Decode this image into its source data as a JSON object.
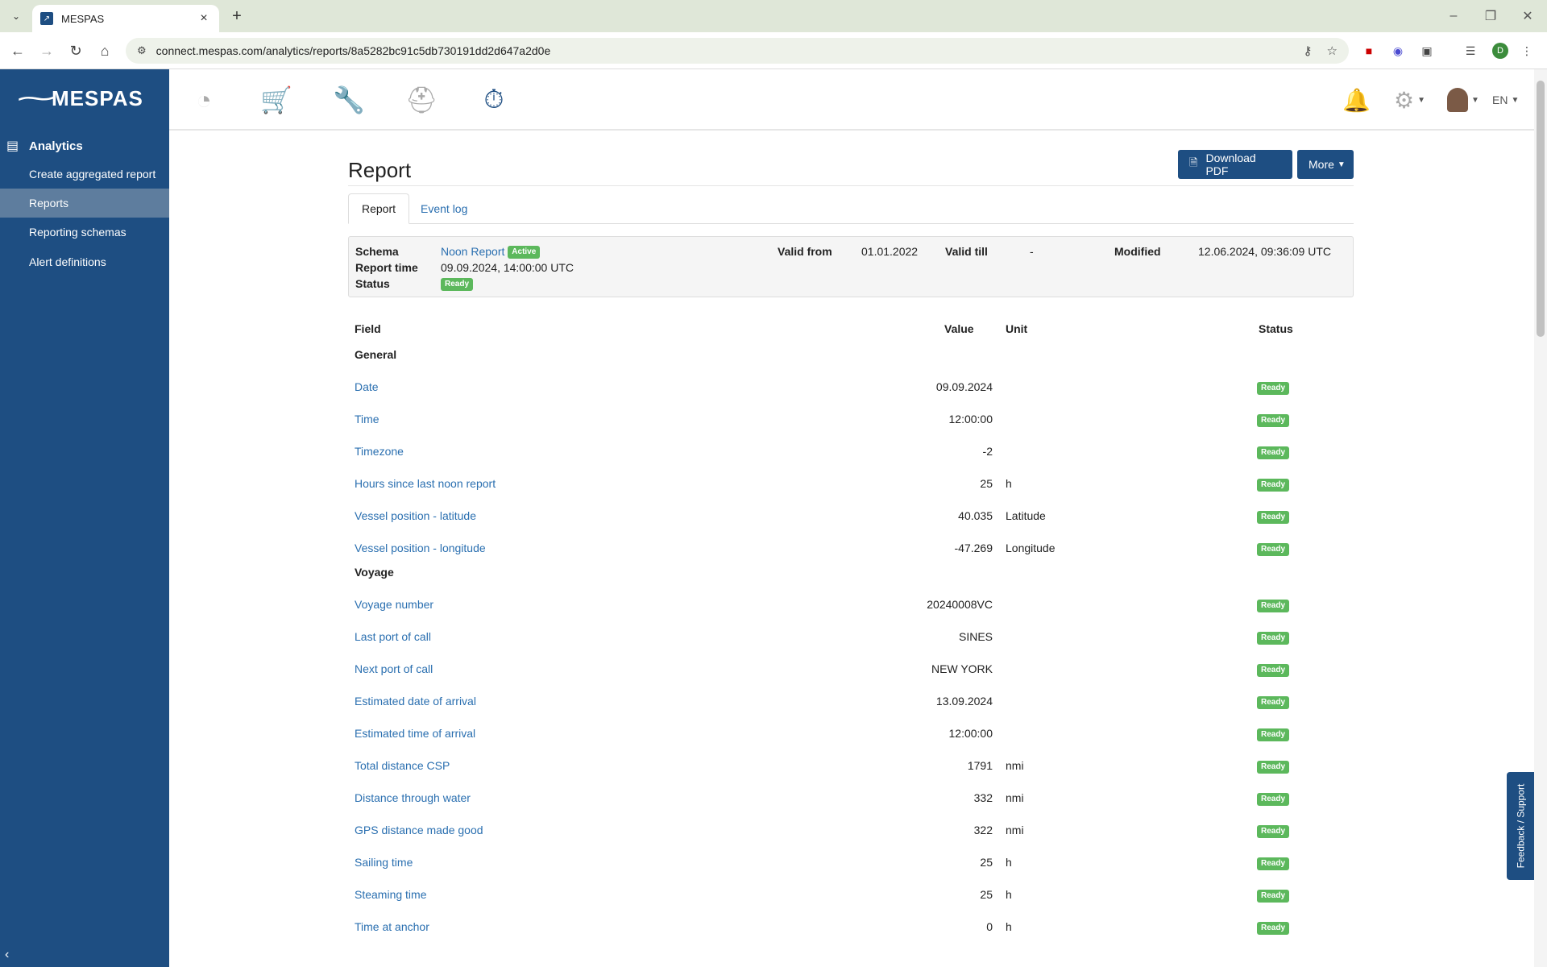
{
  "browser": {
    "tab_title": "MESPAS",
    "url": "connect.mespas.com/analytics/reports/8a5282bc91c5db730191dd2d647a2d0e",
    "profile_initial": "D"
  },
  "app": {
    "logo_text": "MESPAS",
    "section_label": "Analytics",
    "sidebar": [
      {
        "label": "Create aggregated report"
      },
      {
        "label": "Reports"
      },
      {
        "label": "Reporting schemas"
      },
      {
        "label": "Alert definitions"
      }
    ],
    "language": "EN"
  },
  "page": {
    "title": "Report",
    "download_label": "Download PDF",
    "more_label": "More",
    "tabs": [
      {
        "label": "Report"
      },
      {
        "label": "Event log"
      }
    ]
  },
  "info": {
    "schema_label": "Schema",
    "schema_value": "Noon Report",
    "schema_badge": "Active",
    "report_time_label": "Report time",
    "report_time_value": "09.09.2024, 14:00:00 UTC",
    "status_label": "Status",
    "status_badge": "Ready",
    "valid_from_label": "Valid from",
    "valid_from_value": "01.01.2022",
    "valid_till_label": "Valid till",
    "valid_till_value": "-",
    "modified_label": "Modified",
    "modified_value": "12.06.2024, 09:36:09 UTC"
  },
  "table": {
    "headers": {
      "field": "Field",
      "value": "Value",
      "unit": "Unit",
      "status": "Status"
    },
    "groups": [
      {
        "name": "General",
        "rows": [
          {
            "field": "Date",
            "value": "09.09.2024",
            "unit": "",
            "status": "Ready"
          },
          {
            "field": "Time",
            "value": "12:00:00",
            "unit": "",
            "status": "Ready"
          },
          {
            "field": "Timezone",
            "value": "-2",
            "unit": "",
            "status": "Ready"
          },
          {
            "field": "Hours since last noon report",
            "value": "25",
            "unit": "h",
            "status": "Ready"
          },
          {
            "field": "Vessel position - latitude",
            "value": "40.035",
            "unit": "Latitude",
            "status": "Ready"
          },
          {
            "field": "Vessel position - longitude",
            "value": "-47.269",
            "unit": "Longitude",
            "status": "Ready"
          }
        ]
      },
      {
        "name": "Voyage",
        "rows": [
          {
            "field": "Voyage number",
            "value": "20240008VC",
            "unit": "",
            "status": "Ready"
          },
          {
            "field": "Last port of call",
            "value": "SINES",
            "unit": "",
            "status": "Ready"
          },
          {
            "field": "Next port of call",
            "value": "NEW YORK",
            "unit": "",
            "status": "Ready"
          },
          {
            "field": "Estimated date of arrival",
            "value": "13.09.2024",
            "unit": "",
            "status": "Ready"
          },
          {
            "field": "Estimated time of arrival",
            "value": "12:00:00",
            "unit": "",
            "status": "Ready"
          },
          {
            "field": "Total distance CSP",
            "value": "1791",
            "unit": "nmi",
            "status": "Ready"
          },
          {
            "field": "Distance through water",
            "value": "332",
            "unit": "nmi",
            "status": "Ready"
          },
          {
            "field": "GPS distance made good",
            "value": "322",
            "unit": "nmi",
            "status": "Ready"
          },
          {
            "field": "Sailing time",
            "value": "25",
            "unit": "h",
            "status": "Ready"
          },
          {
            "field": "Steaming time",
            "value": "25",
            "unit": "h",
            "status": "Ready"
          },
          {
            "field": "Time at anchor",
            "value": "0",
            "unit": "h",
            "status": "Ready"
          }
        ]
      }
    ]
  },
  "feedback_label": "Feedback / Support",
  "icons": {
    "modules": [
      "dashboard-icon",
      "cart-icon",
      "wrench-icon",
      "helmet-icon",
      "stopwatch-icon"
    ],
    "header": [
      "bell-icon",
      "gear-icon",
      "avatar"
    ],
    "accent": "#1e4e82",
    "badge_green": "#5cb85c",
    "link_blue": "#2a6fb0"
  }
}
